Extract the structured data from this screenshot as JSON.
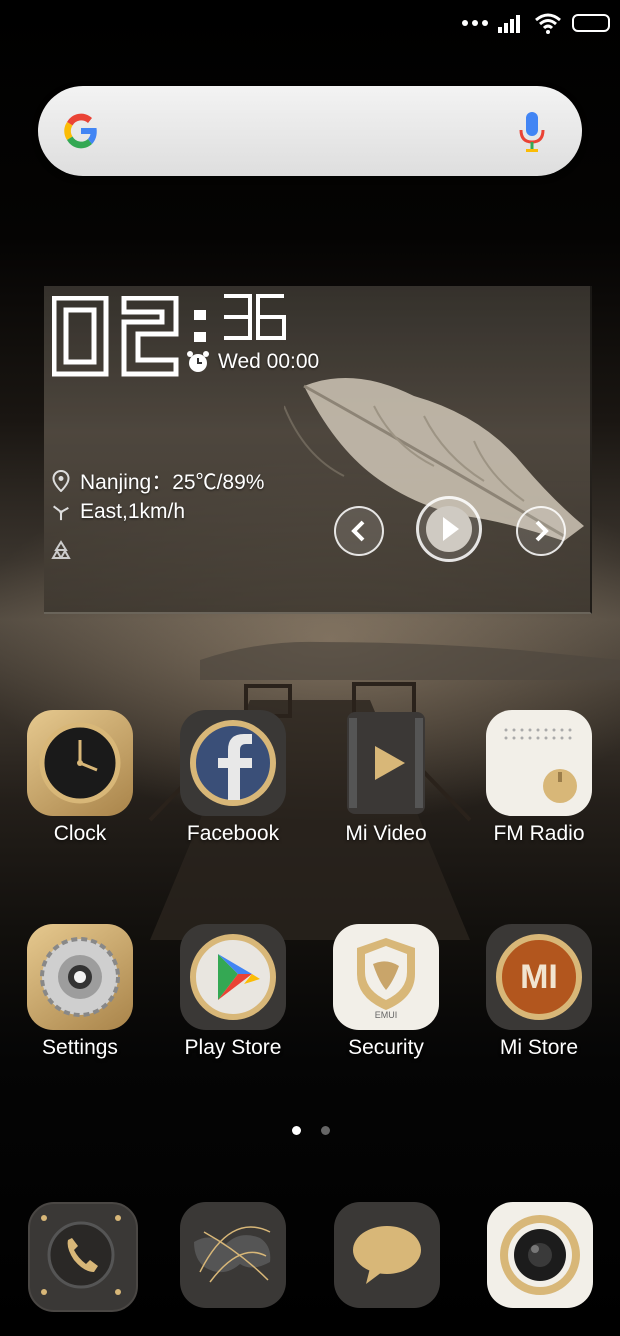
{
  "status_bar": {
    "icons": [
      "dots-icon",
      "signal-icon",
      "wifi-icon",
      "battery-icon"
    ]
  },
  "search": {
    "icons": [
      "google-logo-icon",
      "mic-icon"
    ]
  },
  "widget": {
    "hour": "02",
    "minute": "36",
    "alarm": "Wed 00:00",
    "location": "Nanjing：25℃/89%",
    "wind": "East,1km/h",
    "media_buttons": [
      "previous",
      "play",
      "next"
    ]
  },
  "apps": [
    {
      "label": "Clock",
      "icon": "clock-icon"
    },
    {
      "label": "Facebook",
      "icon": "facebook-icon"
    },
    {
      "label": "Mi Video",
      "icon": "mi-video-icon"
    },
    {
      "label": "FM Radio",
      "icon": "fm-radio-icon"
    },
    {
      "label": "Settings",
      "icon": "settings-icon"
    },
    {
      "label": "Play Store",
      "icon": "play-store-icon"
    },
    {
      "label": "Security",
      "icon": "security-icon",
      "badge": "EMUI"
    },
    {
      "label": "Mi Store",
      "icon": "mi-store-icon",
      "badge": "MI"
    }
  ],
  "pager": {
    "pages": 2,
    "current": 1
  },
  "dock": [
    {
      "icon": "phone-icon"
    },
    {
      "icon": "browser-globe-icon"
    },
    {
      "icon": "messages-icon"
    },
    {
      "icon": "camera-icon"
    }
  ],
  "colors": {
    "gold": "#c9a56a",
    "dark_tile": "#3a3836",
    "cream": "#f2efe8"
  }
}
